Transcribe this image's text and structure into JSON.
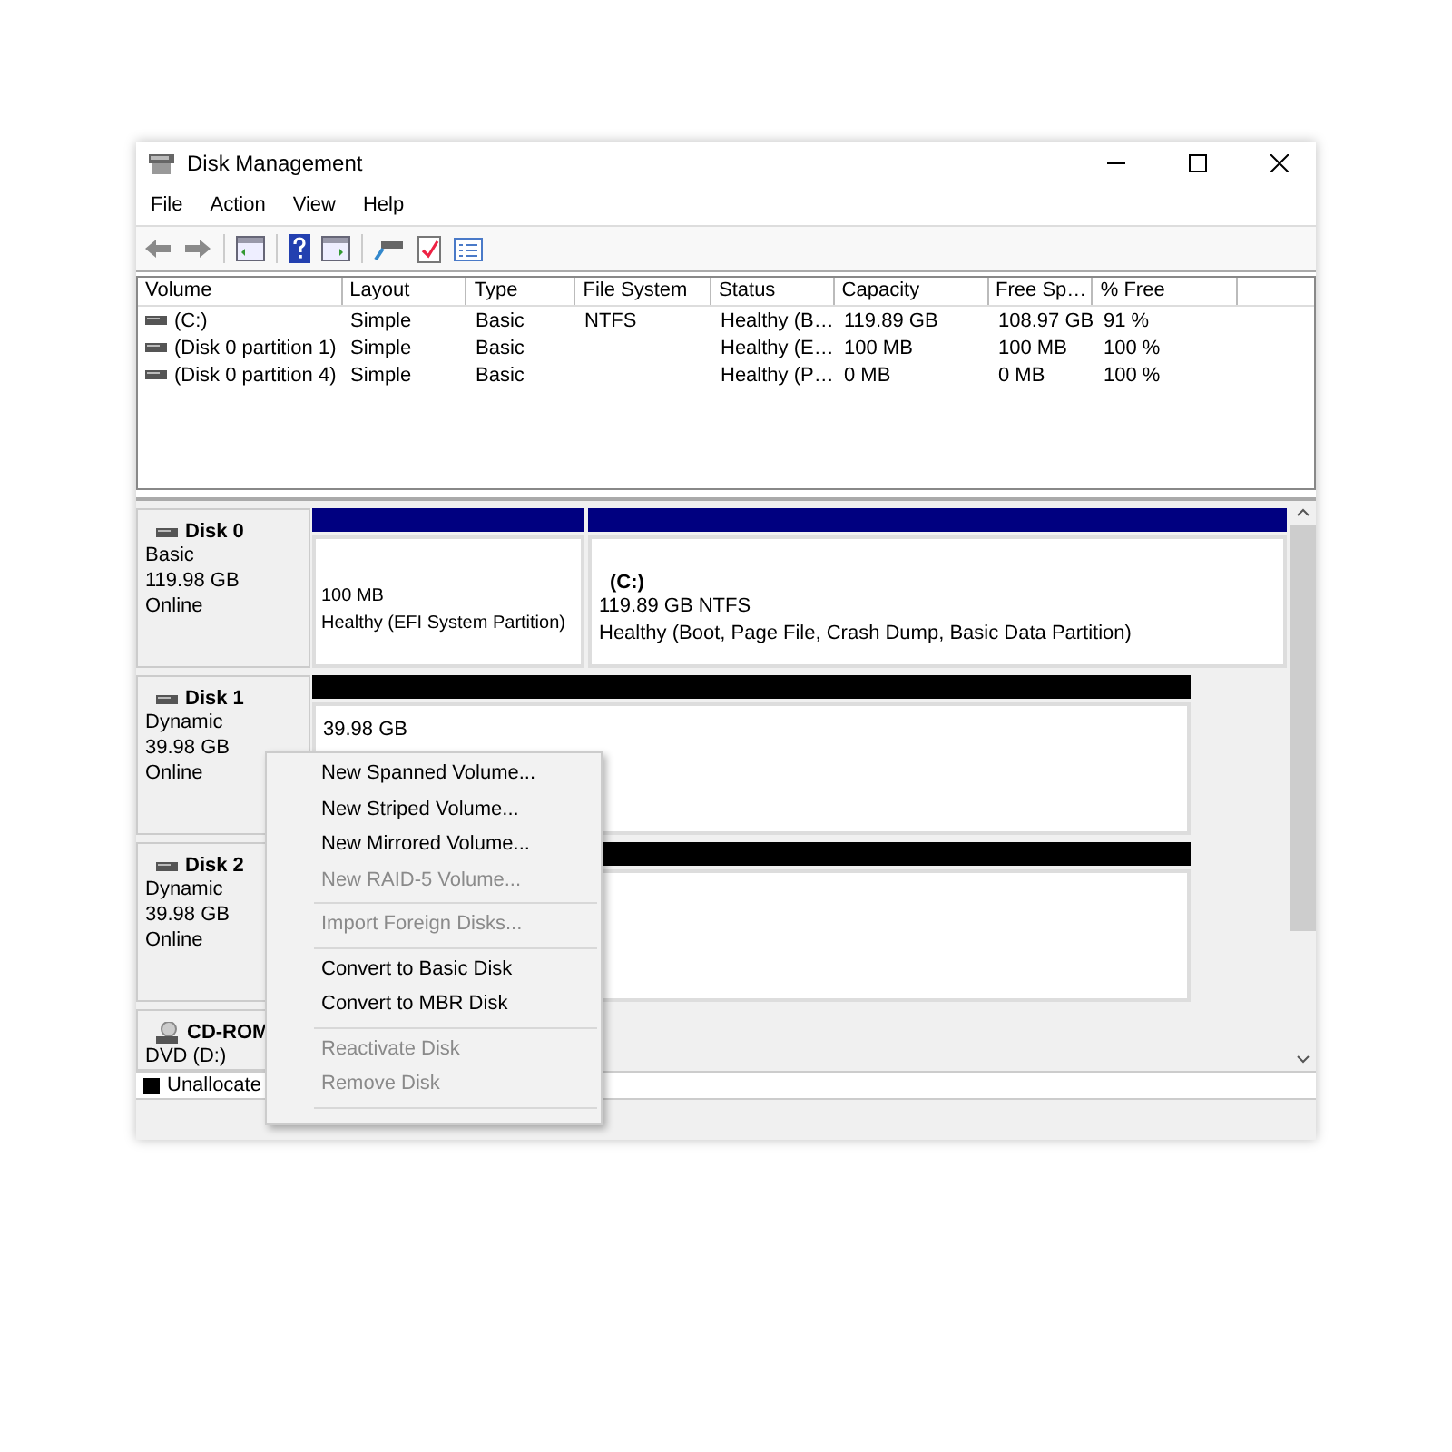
{
  "window": {
    "title": "Disk Management"
  },
  "menu": [
    "File",
    "Action",
    "View",
    "Help"
  ],
  "volume_table": {
    "columns": [
      "Volume",
      "Layout",
      "Type",
      "File System",
      "Status",
      "Capacity",
      "Free Sp…",
      "% Free"
    ],
    "rows": [
      [
        "(C:)",
        "Simple",
        "Basic",
        "NTFS",
        "Healthy (B…",
        "119.89 GB",
        "108.97 GB",
        "91 %"
      ],
      [
        "(Disk 0 partition 1)",
        "Simple",
        "Basic",
        "",
        "Healthy (E…",
        "100 MB",
        "100 MB",
        "100 %"
      ],
      [
        "(Disk 0 partition 4)",
        "Simple",
        "Basic",
        "",
        "Healthy (P…",
        "0 MB",
        "0 MB",
        "100 %"
      ]
    ]
  },
  "disks": [
    {
      "kind": "disk",
      "name": "Disk 0",
      "type": "Basic",
      "size": "119.98 GB",
      "status": "Online",
      "partitions": [
        {
          "kind": "system",
          "color": "#000080",
          "lines": [
            "100 MB",
            "Healthy (EFI System Partition)"
          ]
        },
        {
          "kind": "primary",
          "color": "#000080",
          "title": "(C:)",
          "lines": [
            "119.89 GB NTFS",
            "Healthy (Boot, Page File, Crash Dump, Basic Data Partition)"
          ]
        }
      ]
    },
    {
      "kind": "disk",
      "name": "Disk 1",
      "type": "Dynamic",
      "size": "39.98 GB",
      "status": "Online",
      "partitions": [
        {
          "kind": "unallocated",
          "color": "#000000",
          "lines": [
            "39.98 GB"
          ]
        }
      ]
    },
    {
      "kind": "disk",
      "name": "Disk 2",
      "type": "Dynamic",
      "size": "39.98 GB",
      "status": "Online",
      "partitions": [
        {
          "kind": "unallocated",
          "color": "#000000"
        }
      ]
    },
    {
      "kind": "cdrom",
      "name": "CD-ROM",
      "type": "DVD (D:)"
    }
  ],
  "legend": [
    {
      "label": "Unallocate",
      "color": "#000000"
    }
  ],
  "context_menu": [
    {
      "kind": "item",
      "label": "New Spanned Volume...",
      "disabled": false
    },
    {
      "kind": "item",
      "label": "New Striped Volume...",
      "disabled": false
    },
    {
      "kind": "item",
      "label": "New Mirrored Volume...",
      "disabled": false
    },
    {
      "kind": "item",
      "label": "New RAID-5 Volume...",
      "disabled": true
    },
    {
      "kind": "separator"
    },
    {
      "kind": "item",
      "label": "Import Foreign Disks...",
      "disabled": true
    },
    {
      "kind": "separator"
    },
    {
      "kind": "item",
      "label": "Convert to Basic Disk",
      "disabled": false
    },
    {
      "kind": "item",
      "label": "Convert to MBR Disk",
      "disabled": false
    },
    {
      "kind": "separator"
    },
    {
      "kind": "item",
      "label": "Reactivate Disk",
      "disabled": true
    },
    {
      "kind": "item",
      "label": "Remove Disk",
      "disabled": true
    },
    {
      "kind": "separator"
    }
  ]
}
